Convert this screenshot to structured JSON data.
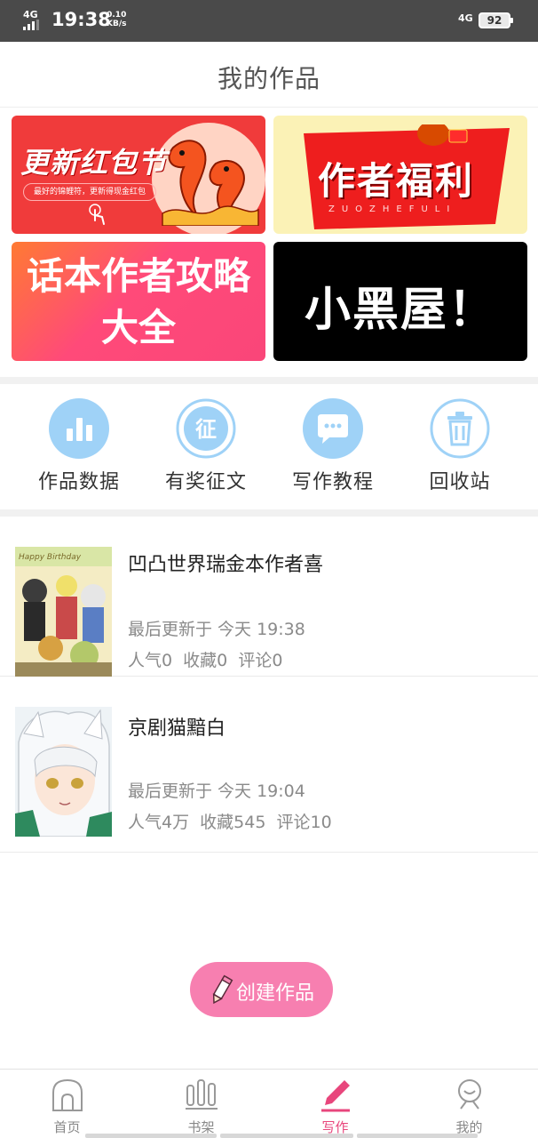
{
  "status_bar": {
    "network_left": "4G",
    "time": "19:38",
    "speed_value": "0.10",
    "speed_unit": "KB/s",
    "network_right": "4G",
    "battery": "92"
  },
  "header": {
    "title": "我的作品"
  },
  "banners": [
    {
      "title": "更新红包节",
      "subtitle": "最好的锦鲤符，更新得现金红包"
    },
    {
      "title": "作者福利",
      "subtitle": "ZUOZHEFULI"
    },
    {
      "title_line1": "话本作者攻略",
      "title_line2": "大全"
    },
    {
      "title": "小黑屋！"
    }
  ],
  "actions": [
    {
      "label": "作品数据",
      "icon": "bar-chart-icon"
    },
    {
      "label": "有奖征文",
      "icon": "contest-icon",
      "glyph": "征"
    },
    {
      "label": "写作教程",
      "icon": "chat-bubble-icon"
    },
    {
      "label": "回收站",
      "icon": "trash-icon"
    }
  ],
  "works": [
    {
      "title": "凹凸世界瑞金本作者喜",
      "updated": "最后更新于 今天 19:38",
      "stats": "人气0  收藏0  评论0",
      "cover_text": "Happy Birthday"
    },
    {
      "title": "京剧猫黯白",
      "updated": "最后更新于 今天 19:04",
      "stats": "人气4万  收藏545  评论10"
    }
  ],
  "create_button": {
    "label": "创建作品"
  },
  "nav": {
    "items": [
      {
        "label": "首页",
        "icon": "home-icon"
      },
      {
        "label": "书架",
        "icon": "bookshelf-icon"
      },
      {
        "label": "写作",
        "icon": "pencil-icon",
        "active": true
      },
      {
        "label": "我的",
        "icon": "profile-icon"
      }
    ]
  },
  "colors": {
    "accent_pink": "#f77fb0",
    "nav_active": "#e8467c",
    "action_blue": "#9fd2f7",
    "status_bar_bg": "#4a4a4a"
  }
}
